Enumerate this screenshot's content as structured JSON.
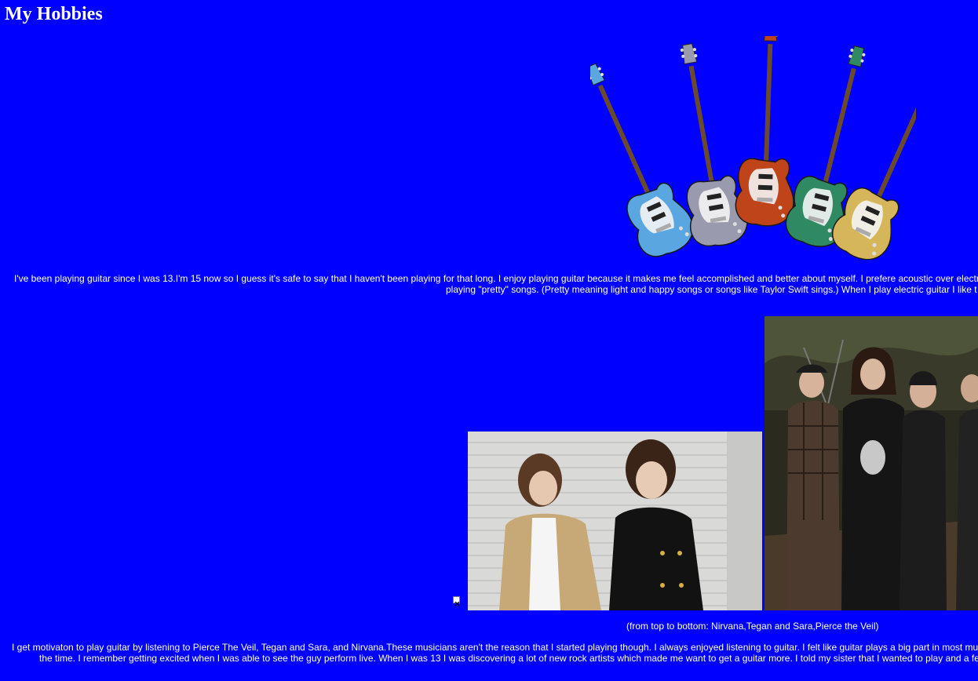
{
  "page": {
    "title": "My Hobbies",
    "background_color": "#0000ff",
    "text_color": "#ffffff"
  },
  "guitars_image": {
    "icon": "guitars-illustration",
    "colors": [
      "#5aa6e0",
      "#9a9aae",
      "#c0441a",
      "#2f8a63",
      "#d6b65a"
    ]
  },
  "paragraph1": {
    "line1": "I've been playing guitar since I was 13.I'm 15 now so I guess it's safe to say that I haven't been playing for that long. I enjoy playing guitar because it makes me feel accomplished and better about myself. I prefere acoustic over electr",
    "line2": "playing \"pretty\" songs. (Pretty meaning light and happy songs or songs like Taylor Swift sings.) When I play electric guitar I like t"
  },
  "photos": {
    "broken_image_icon": "broken-image-icon",
    "tegan_and_sara": "band-photo-tegan-and-sara",
    "pierce_the_veil": "band-photo-pierce-the-veil"
  },
  "caption": "(from top to bottom: Nirvana,Tegan and Sara,Pierce the Veil)",
  "paragraph2": {
    "line1": "I get motivaton to play guitar by listening to Pierce The Veil, Tegan and Sara, and Nirvana.These musicians aren't the reason that I started playing though. I always enjoyed listening to guitar. I felt like guitar plays a big part in most mu",
    "line2": "the time. I remember getting excited when I was able to see the guy perform live. When I was 13 I was discovering a lot of new rock artists which made me want to get a guitar more. I told my sister that I wanted to play and a fe"
  }
}
